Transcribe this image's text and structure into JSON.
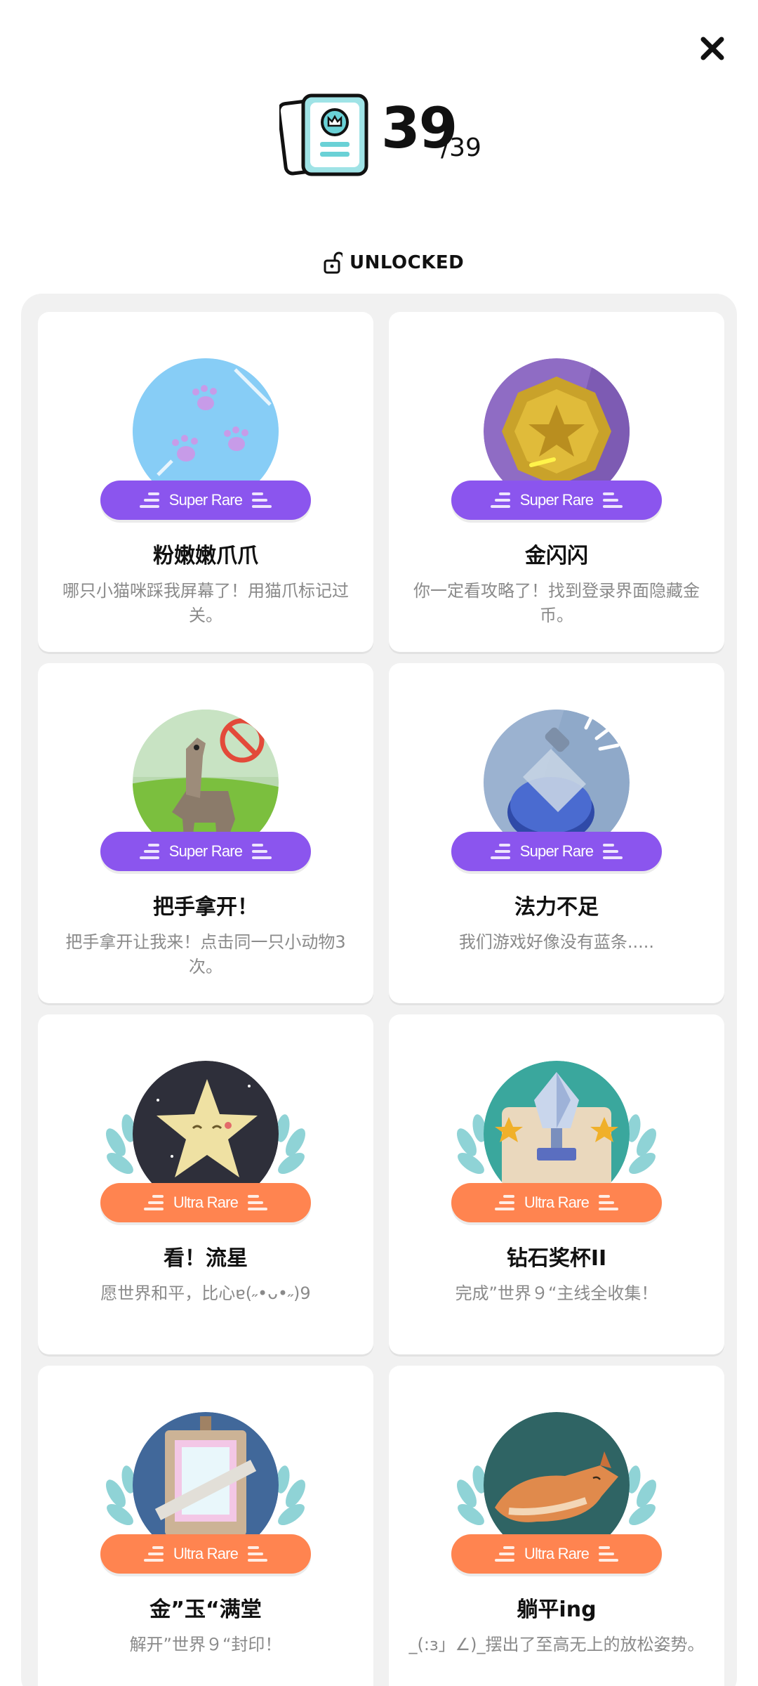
{
  "header": {
    "count": "39",
    "total": "/39",
    "status_label": "UNLOCKED"
  },
  "colors": {
    "super_rare": "#8b55ee",
    "ultra_rare": "#ff8450",
    "panel": "#f1f1f1",
    "laurel": "#8fd3d6"
  },
  "achievements": [
    {
      "title": "粉嫩嫩爪爪",
      "desc": "哪只小猫咪踩我屏幕了！用猫爪标记过关。",
      "rarity": "Super Rare",
      "icon": "cat-paw-icon"
    },
    {
      "title": "金闪闪",
      "desc": "你一定看攻略了！找到登录界面隐藏金币。",
      "rarity": "Super Rare",
      "icon": "gold-coin-icon"
    },
    {
      "title": "把手拿开！",
      "desc": "把手拿开让我来！点击同一只小动物3次。",
      "rarity": "Super Rare",
      "icon": "llama-icon"
    },
    {
      "title": "法力不足",
      "desc": "我们游戏好像没有蓝条.....",
      "rarity": "Super Rare",
      "icon": "potion-bottle-icon"
    },
    {
      "title": "看！流星",
      "desc": "愿世界和平，比心ɐ(˶•ᴗ•˶)9",
      "rarity": "Ultra Rare",
      "icon": "shooting-star-icon"
    },
    {
      "title": "钻石奖杯II",
      "desc": "完成”世界９“主线全收集！",
      "rarity": "Ultra Rare",
      "icon": "diamond-trophy-icon"
    },
    {
      "title": "金”玉“满堂",
      "desc": "解开”世界９“封印！",
      "rarity": "Ultra Rare",
      "icon": "painting-easel-icon"
    },
    {
      "title": "躺平ing",
      "desc": "_(:з」∠)_摆出了至高无上的放松姿势。",
      "rarity": "Ultra Rare",
      "icon": "sleeping-fox-icon"
    }
  ]
}
